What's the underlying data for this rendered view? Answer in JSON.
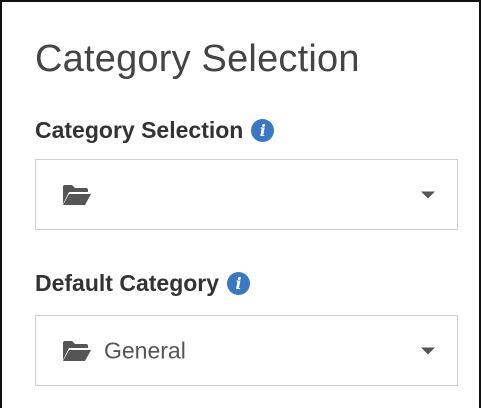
{
  "panel": {
    "title": "Category Selection"
  },
  "fields": [
    {
      "label": "Category Selection",
      "info_icon": "info-circle-icon",
      "value": "",
      "value_icon": "folder-open-icon",
      "dropdown_icon": "caret-down-icon"
    },
    {
      "label": "Default Category",
      "info_icon": "info-circle-icon",
      "value": "General",
      "value_icon": "folder-open-icon",
      "dropdown_icon": "caret-down-icon"
    }
  ],
  "colors": {
    "info_icon": "#3a78c4",
    "label_text": "#333333",
    "title_text": "#444444",
    "field_border": "#cfcfcf",
    "icon_gray": "#555555"
  }
}
